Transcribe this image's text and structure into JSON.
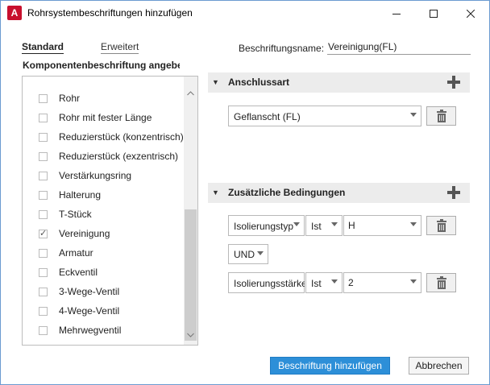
{
  "window": {
    "app_icon": "A",
    "title": "Rohrsystembeschriftungen hinzufügen",
    "controls": [
      "minimize-icon",
      "maximize-icon",
      "close-icon"
    ]
  },
  "tabs": [
    {
      "label": "Standard",
      "active": true
    },
    {
      "label": "Erweitert",
      "active": false
    }
  ],
  "component_section": {
    "title": "Komponentenbeschriftung angebe",
    "items": [
      {
        "label": "Rohr",
        "checked": false
      },
      {
        "label": "Rohr mit fester Länge",
        "checked": false
      },
      {
        "label": "Reduzierstück (konzentrisch)",
        "checked": false
      },
      {
        "label": "Reduzierstück (exzentrisch)",
        "checked": false
      },
      {
        "label": "Verstärkungsring",
        "checked": false
      },
      {
        "label": "Halterung",
        "checked": false
      },
      {
        "label": "T-Stück",
        "checked": false
      },
      {
        "label": "Vereinigung",
        "checked": true
      },
      {
        "label": "Armatur",
        "checked": false
      },
      {
        "label": "Eckventil",
        "checked": false
      },
      {
        "label": "3-Wege-Ventil",
        "checked": false
      },
      {
        "label": "4-Wege-Ventil",
        "checked": false
      },
      {
        "label": "Mehrwegventil",
        "checked": false
      }
    ]
  },
  "name_field": {
    "label": "Beschriftungsname:",
    "value": "Vereinigung(FL)"
  },
  "connection_group": {
    "title": "Anschlussart",
    "value": "Geflanscht (FL)"
  },
  "conditions_group": {
    "title": "Zusätzliche Bedingungen",
    "row1": {
      "property": "Isolierungstyp",
      "operator": "Ist",
      "value": "H"
    },
    "logic": "UND",
    "row2": {
      "property": "Isolierungsstärke",
      "operator": "Ist",
      "value": "2"
    }
  },
  "buttons": {
    "add": "Beschriftung hinzufügen",
    "cancel": "Abbrechen"
  },
  "colors": {
    "primary": "#2d8fd8",
    "group_header": "#ececec"
  }
}
